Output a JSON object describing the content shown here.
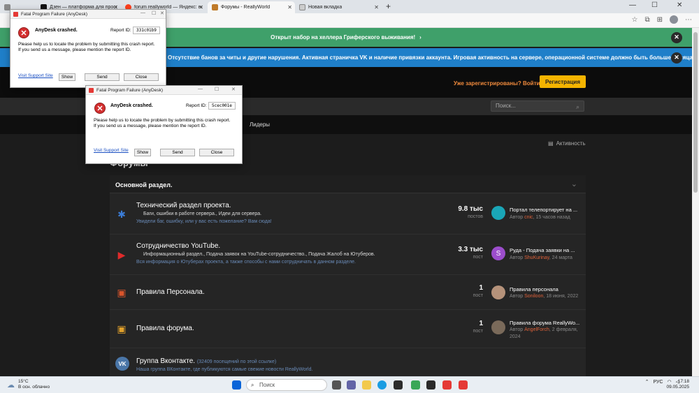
{
  "browser": {
    "tabs": [
      {
        "title": "Дзен — платформа для просм",
        "color": "#111111"
      },
      {
        "title": "forum reallyworld — Яндекс: на",
        "color": "#fc3f1d"
      },
      {
        "title": "Форумы - ReallyWorld",
        "color": "#c07b2a"
      },
      {
        "title": "Новая вкладка",
        "color": "#6a6a6a"
      }
    ],
    "new_tab": "+"
  },
  "notices": {
    "green": "Открыт набор на хеллера Гриферского выживания!",
    "blue": "Отсутствие банов за читы и другие нарушения. Активная страничка VK и наличие привязки аккаунта. Игровая активность на сервере, операционной системе должно быть больше месяца."
  },
  "header": {
    "login": "Уже зарегистрированы? Войти",
    "register": "Регистрация",
    "search_placeholder": "Поиск..."
  },
  "nav": {
    "leaders": "Лидеры"
  },
  "main": {
    "activity": "Активность",
    "forums_title": "Форумы",
    "section_title": "Основной раздел.",
    "rows": [
      {
        "name": "Технический раздел проекта.",
        "subs": "Баги, ошибки в работе сервера.,   Идеи для сервера.",
        "desc": "Увидели баг, ошибку, или у вас есть пожелание? Вам сюда!",
        "count": "9.8 тыс",
        "count_label": "постов",
        "last_title": "Портал телепортирует на ...",
        "last_prefix": "Автор",
        "last_user": "cnic",
        "last_time": ", 15 часов назад",
        "avatar_color": "#1aa6b7"
      },
      {
        "name": "Сотрудничество YouTube.",
        "subs": "Информационный раздел.,   Подача заявок на YouTube-сотрудничество.,   Подача Жалоб на Ютуберов.",
        "desc": "Вся информация о Ютуберах проекта, а также способы с нами сотрудничать в данном разделе.",
        "count": "3.3 тыс",
        "count_label": "пост",
        "last_title": "Руда - Подача заявки на ...",
        "last_prefix": "Автор",
        "last_user": "ShuKurinay",
        "last_time": ", 24 марта",
        "avatar_color": "#9c4dcc",
        "avatar_letter": "S"
      },
      {
        "name": "Правила Персонала.",
        "count": "1",
        "count_label": "пост",
        "last_title": "Правила персонала",
        "last_prefix": "Автор",
        "last_user": "Soniloon",
        "last_time": ", 18 июня, 2022",
        "avatar_color": "#b5927a"
      },
      {
        "name": "Правила форума.",
        "count": "1",
        "count_label": "пост",
        "last_title": "Правила форума ReallyWo...",
        "last_prefix": "Автор",
        "last_user": "AngelForch",
        "last_time": ", 2 февраля,",
        "last_time2": "2024",
        "avatar_color": "#7a6a5a"
      },
      {
        "name": "Группа Вконтакте.",
        "name_extra": "(32409 посещений по этой ссылке)",
        "desc": "Наша группа ВКонтакте, где публикуются самые свежие новости ReallyWorld."
      }
    ]
  },
  "dialogs": [
    {
      "title": "Fatal Program Failure (AnyDesk)",
      "heading": "AnyDesk crashed.",
      "report_label": "Report ID:",
      "report_id": "331c01b9",
      "line1": "Please help us to locate the problem by submitting this crash report.",
      "line2": "If you send us a message, please mention the report ID.",
      "link": "Visit Support Site",
      "show": "Show",
      "send": "Send",
      "close": "Close"
    },
    {
      "title": "Fatal Program Failure (AnyDesk)",
      "heading": "AnyDesk crashed.",
      "report_label": "Report ID:",
      "report_id": "5cec001e",
      "line1": "Please help us to locate the problem by submitting this crash report.",
      "line2": "If you send us a message, please mention the report ID.",
      "link": "Visit Support Site",
      "show": "Show",
      "send": "Send",
      "close": "Close"
    }
  ],
  "taskbar": {
    "temp": "15°C",
    "weather": "В осн. облачно",
    "search": "Поиск",
    "lang": "РУС",
    "time": "17:18",
    "date": "09.05.2025"
  }
}
